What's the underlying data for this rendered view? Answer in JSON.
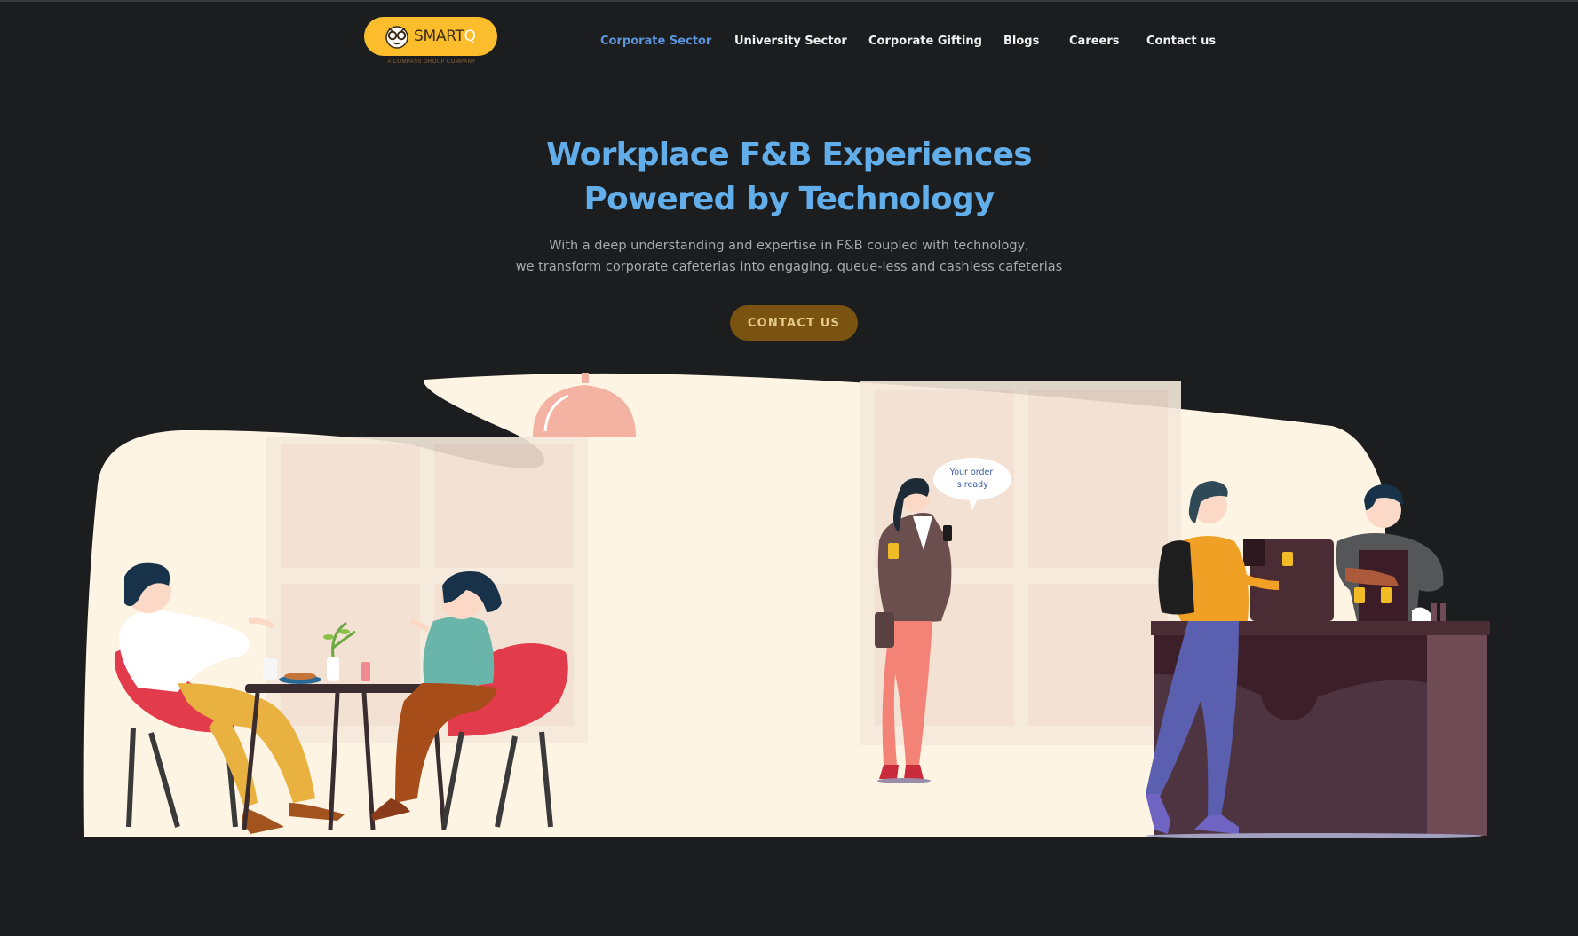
{
  "brand": {
    "name_main": "SMART",
    "name_accent": "Q",
    "tagline": "A COMPASS GROUP COMPANY"
  },
  "nav": {
    "items": [
      {
        "label": "Corporate Sector",
        "active": true
      },
      {
        "label": "University Sector",
        "active": false
      },
      {
        "label": "Corporate Gifting",
        "active": false
      },
      {
        "label": "Blogs",
        "active": false
      },
      {
        "label": "Careers",
        "active": false
      },
      {
        "label": "Contact us",
        "active": false
      }
    ]
  },
  "hero": {
    "title_line1": "Workplace F&B Experiences",
    "title_line2": "Powered by Technology",
    "subtitle_line1": "With a deep understanding and expertise in F&B coupled with technology,",
    "subtitle_line2": "we transform corporate cafeterias into engaging, queue-less and cashless cafeterias",
    "cta_label": "CONTACT US"
  },
  "illustration": {
    "bubble_line1": "Your order",
    "bubble_line2": "is ready"
  },
  "colors": {
    "background": "#1c1d1f",
    "accent_blue": "#62aeea",
    "nav_active": "#5b95dd",
    "logo_yellow": "#fbbd2c",
    "cta_brown": "#7a5310",
    "scene_cream": "#fdf4e4"
  }
}
